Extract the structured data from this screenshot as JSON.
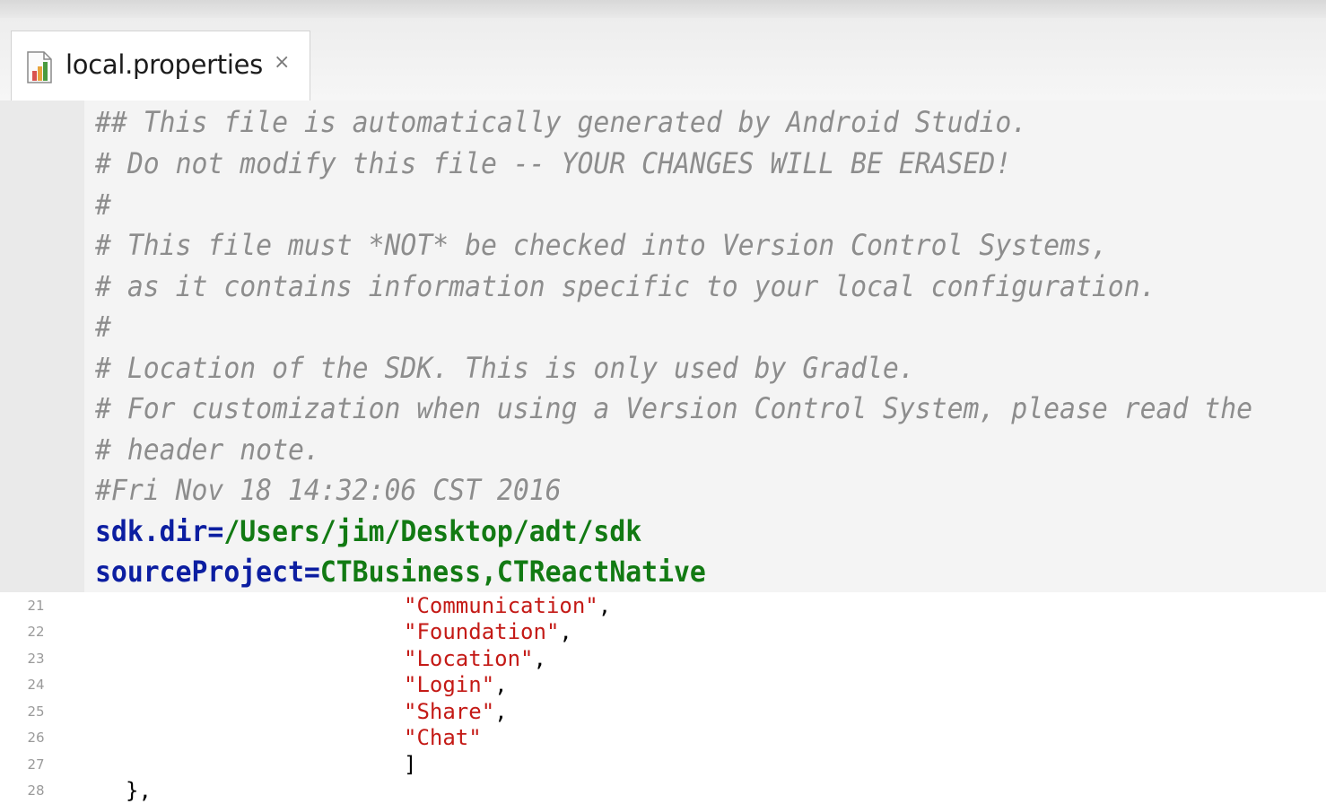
{
  "tab": {
    "title": "local.properties",
    "close_glyph": "×",
    "icon": "properties-file-icon"
  },
  "properties_file": {
    "comments": [
      "## This file is automatically generated by Android Studio.",
      "# Do not modify this file -- YOUR CHANGES WILL BE ERASED!",
      "#",
      "# This file must *NOT* be checked into Version Control Systems,",
      "# as it contains information specific to your local configuration.",
      "#",
      "# Location of the SDK. This is only used by Gradle.",
      "# For customization when using a Version Control System, please read the",
      "# header note.",
      "#Fri Nov 18 14:32:06 CST 2016"
    ],
    "properties": [
      {
        "key": "sdk.dir",
        "value": "/Users/jim/Desktop/adt/sdk"
      },
      {
        "key": "sourceProject",
        "value": "CTBusiness,CTReactNative"
      }
    ]
  },
  "json_snippet": {
    "lines": [
      {
        "number": "21",
        "text": "\"Communication\"",
        "trail": ","
      },
      {
        "number": "22",
        "text": "\"Foundation\"",
        "trail": ","
      },
      {
        "number": "23",
        "text": "\"Location\"",
        "trail": ","
      },
      {
        "number": "24",
        "text": "\"Login\"",
        "trail": ","
      },
      {
        "number": "25",
        "text": "\"Share\"",
        "trail": ","
      },
      {
        "number": "26",
        "text": "\"Chat\"",
        "trail": ""
      },
      {
        "number": "27",
        "text": "",
        "trail": "]"
      },
      {
        "number": "28",
        "text": "",
        "trail": "},"
      }
    ]
  },
  "colors": {
    "comment": "#8d8d8d",
    "key": "#0c1ea1",
    "value": "#127a13",
    "string": "#c41a16"
  }
}
